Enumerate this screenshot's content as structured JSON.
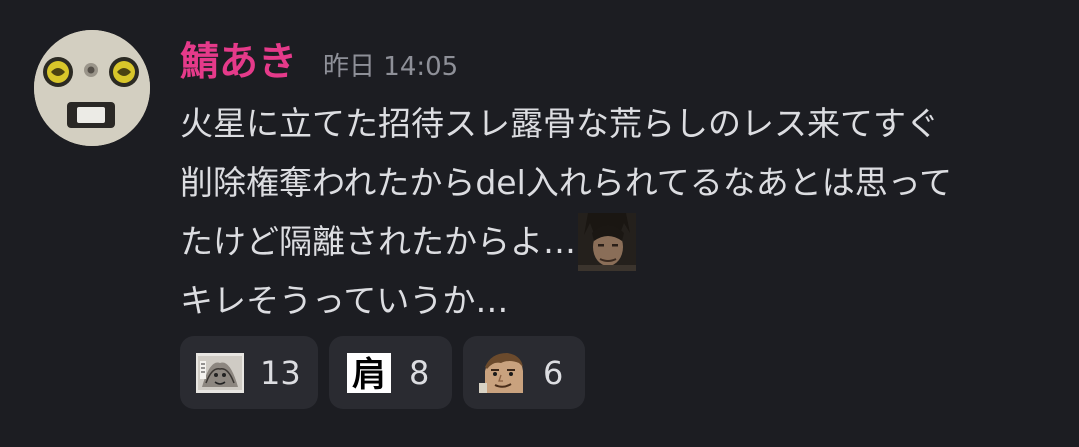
{
  "message": {
    "author": {
      "name": "鯖あき",
      "name_color": "#e53a8a",
      "avatar": "robot-face-avatar"
    },
    "timestamp": "昨日 14:05",
    "lines": [
      "火星に立てた招待スレ露骨な荒らしのレス来てすぐ",
      "削除権奪われたからdel入れられてるなあとは思って",
      "たけど隔離されたからよ…",
      "キレそうっていうか…"
    ],
    "inline_emoji": "dark-haired-man-face-emoji"
  },
  "reactions": [
    {
      "emoji": "manga-panel-emoji",
      "count": "13"
    },
    {
      "emoji": "kanji-kata-emoji",
      "glyph": "肩",
      "count": "8"
    },
    {
      "emoji": "anime-face-emoji",
      "count": "6"
    }
  ],
  "colors": {
    "background": "#1c1d22",
    "text": "#dcdde1",
    "muted": "#8e9098",
    "reaction_bg": "#2a2b31"
  }
}
